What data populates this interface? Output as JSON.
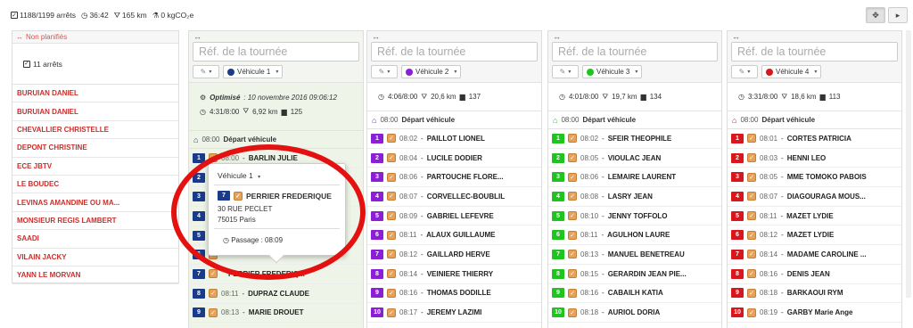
{
  "stats": {
    "arrets": "1188/1199 arrêts",
    "duree": "36:42",
    "distance": "165 km",
    "co2": "0 kgCO₂e"
  },
  "unplanned": {
    "title": "Non planifiés",
    "count": "11 arrêts",
    "items": [
      "BURUIAN DANIEL",
      "BURUIAN DANIEL",
      "CHEVALLIER CHRISTELLE",
      "DEPONT CHRISTINE",
      "ECE JBTV",
      "LE BOUDEC",
      "LEVINAS AMANDINE OU MA...",
      "MONSIEUR REGIS LAMBERT",
      "SAADI",
      "VILAIN JACKY",
      "YANN LE MORVAN"
    ]
  },
  "columns": [
    {
      "ref_placeholder": "Réf. de la tournée",
      "vehicle": "Véhicule 1",
      "color": "#1a3a8c",
      "optimized_label": "Optimisé",
      "optimized_date": ": 10 novembre 2016 09:06:12",
      "summary": {
        "time": "4:31/8:00",
        "km": "6,92 km",
        "count": "125"
      },
      "depart_time": "08:00",
      "depart_label": "Départ véhicule",
      "stops": [
        {
          "n": "1",
          "t": "08:00",
          "name": "BARLIN JULIE"
        },
        {
          "n": "2",
          "t": "",
          "name": ""
        },
        {
          "n": "3",
          "t": "",
          "name": ""
        },
        {
          "n": "4",
          "t": "",
          "name": ""
        },
        {
          "n": "5",
          "t": "",
          "name": ""
        },
        {
          "n": "6",
          "t": "",
          "name": ""
        },
        {
          "n": "7",
          "t": "",
          "name": "PERRIER FREDERIQ..."
        },
        {
          "n": "8",
          "t": "08:11",
          "name": "DUPRAZ CLAUDE"
        },
        {
          "n": "9",
          "t": "08:13",
          "name": "MARIE DROUET"
        }
      ]
    },
    {
      "ref_placeholder": "Réf. de la tournée",
      "vehicle": "Véhicule 2",
      "color": "#8b1fd6",
      "summary": {
        "time": "4:06/8:00",
        "km": "20,6 km",
        "count": "137"
      },
      "depart_time": "08:00",
      "depart_label": "Départ véhicule",
      "stops": [
        {
          "n": "1",
          "t": "08:02",
          "name": "PAILLOT LIONEL"
        },
        {
          "n": "2",
          "t": "08:04",
          "name": "LUCILE DODIER"
        },
        {
          "n": "3",
          "t": "08:06",
          "name": "PARTOUCHE FLORE..."
        },
        {
          "n": "4",
          "t": "08:07",
          "name": "CORVELLEC-BOUBLIL"
        },
        {
          "n": "5",
          "t": "08:09",
          "name": "GABRIEL LEFEVRE"
        },
        {
          "n": "6",
          "t": "08:11",
          "name": "ALAUX GUILLAUME"
        },
        {
          "n": "7",
          "t": "08:12",
          "name": "GAILLARD HERVE"
        },
        {
          "n": "8",
          "t": "08:14",
          "name": "VEINIERE THIERRY"
        },
        {
          "n": "9",
          "t": "08:16",
          "name": "THOMAS DODILLE"
        },
        {
          "n": "10",
          "t": "08:17",
          "name": "JEREMY LAZIMI"
        }
      ]
    },
    {
      "ref_placeholder": "Réf. de la tournée",
      "vehicle": "Véhicule 3",
      "color": "#1fc41f",
      "summary": {
        "time": "4:01/8:00",
        "km": "19,7 km",
        "count": "134"
      },
      "depart_time": "08:00",
      "depart_label": "Départ véhicule",
      "stops": [
        {
          "n": "1",
          "t": "08:02",
          "name": "SFEIR THEOPHILE"
        },
        {
          "n": "2",
          "t": "08:05",
          "name": "VIOULAC JEAN"
        },
        {
          "n": "3",
          "t": "08:06",
          "name": "LEMAIRE LAURENT"
        },
        {
          "n": "4",
          "t": "08:08",
          "name": "LASRY JEAN"
        },
        {
          "n": "5",
          "t": "08:10",
          "name": "JENNY TOFFOLO"
        },
        {
          "n": "6",
          "t": "08:11",
          "name": "AGULHON LAURE"
        },
        {
          "n": "7",
          "t": "08:13",
          "name": "MANUEL BENETREAU"
        },
        {
          "n": "8",
          "t": "08:15",
          "name": "GERARDIN JEAN PIE..."
        },
        {
          "n": "9",
          "t": "08:16",
          "name": "CABAILH KATIA"
        },
        {
          "n": "10",
          "t": "08:18",
          "name": "AURIOL DORIA"
        }
      ]
    },
    {
      "ref_placeholder": "Réf. de la tournée",
      "vehicle": "Véhicule 4",
      "color": "#d9161c",
      "summary": {
        "time": "3:31/8:00",
        "km": "18,6 km",
        "count": "113"
      },
      "depart_time": "08:00",
      "depart_label": "Départ véhicule",
      "stops": [
        {
          "n": "1",
          "t": "08:01",
          "name": "CORTES PATRICIA"
        },
        {
          "n": "2",
          "t": "08:03",
          "name": "HENNI LEO"
        },
        {
          "n": "3",
          "t": "08:05",
          "name": "MME TOMOKO PABOIS"
        },
        {
          "n": "4",
          "t": "08:07",
          "name": "DIAGOURAGA MOUS..."
        },
        {
          "n": "5",
          "t": "08:11",
          "name": "MAZET LYDIE"
        },
        {
          "n": "6",
          "t": "08:12",
          "name": "MAZET LYDIE"
        },
        {
          "n": "7",
          "t": "08:14",
          "name": "MADAME CAROLINE ..."
        },
        {
          "n": "8",
          "t": "08:16",
          "name": "DENIS JEAN"
        },
        {
          "n": "9",
          "t": "08:18",
          "name": "BARKAOUI RYM"
        },
        {
          "n": "10",
          "t": "08:19",
          "name": "GARBY Marie Ange"
        }
      ]
    }
  ],
  "popover": {
    "vehicle": "Véhicule 1",
    "stop_number": "7",
    "name": "PERRIER FREDERIQUE",
    "address1": "30 RUE PECLET",
    "address2": "75015 Paris",
    "passage": "Passage : 08:09"
  }
}
